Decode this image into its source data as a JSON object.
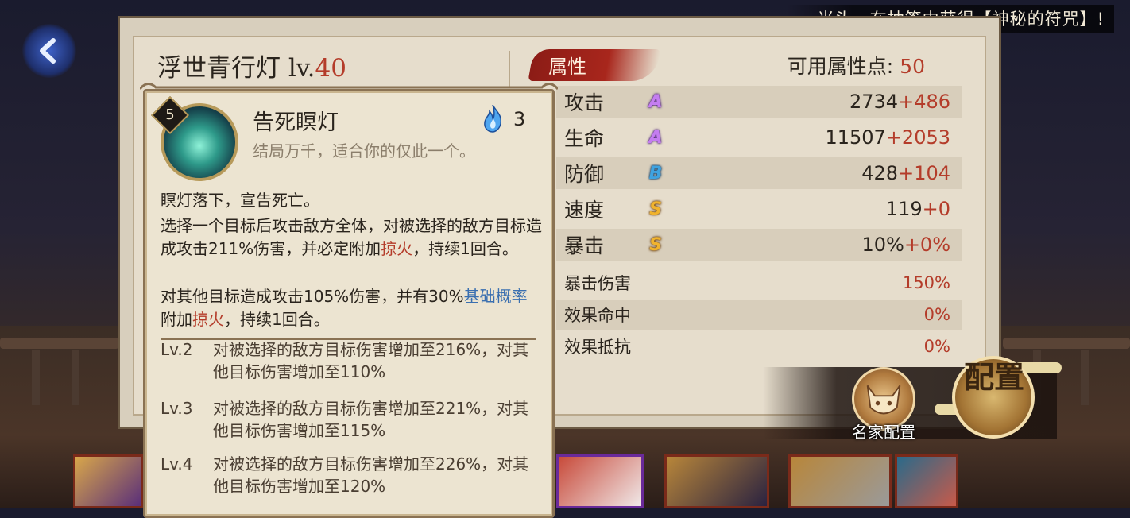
{
  "notice": {
    "text": "当头，在抽签中获得【神秘的符咒】!"
  },
  "shikigami": {
    "name": "浮世青行灯",
    "lv_prefix": "lv.",
    "level": "40"
  },
  "attributes": {
    "section_label": "属性",
    "points_label": "可用属性点:",
    "points_value": "50",
    "stats": [
      {
        "name": "攻击",
        "grade": "A",
        "base": "2734",
        "bonus": "+486"
      },
      {
        "name": "生命",
        "grade": "A",
        "base": "11507",
        "bonus": "+2053"
      },
      {
        "name": "防御",
        "grade": "B",
        "base": "428",
        "bonus": "+104"
      },
      {
        "name": "速度",
        "grade": "S",
        "base": "119",
        "bonus": "+0"
      },
      {
        "name": "暴击",
        "grade": "S",
        "base": "10%",
        "bonus": "+0%"
      }
    ],
    "sub_stats": [
      {
        "name": "暴击伤害",
        "value": "150%"
      },
      {
        "name": "效果命中",
        "value": "0%"
      },
      {
        "name": "效果抵抗",
        "value": "0%"
      }
    ]
  },
  "skill": {
    "badge": "5",
    "name": "告死瞑灯",
    "quote": "结局万千，适合你的仅此一个。",
    "cost": "3",
    "desc1": "瞑灯落下，宣告死亡。",
    "desc2_a": "选择一个目标后攻击敌方全体，对被选择的敌方目标造成攻击211%伤害，并必定附加",
    "desc2_red": "掠火",
    "desc2_b": "，持续1回合。",
    "desc3_a": "对其他目标造成攻击105%伤害，并有30%",
    "desc3_blue": "基础概率",
    "desc3_b": "附加",
    "desc3_red": "掠火",
    "desc3_c": "，持续1回合。",
    "levels": [
      {
        "tag": "Lv.2",
        "text": "对被选择的敌方目标伤害增加至216%，对其他目标伤害增加至110%"
      },
      {
        "tag": "Lv.3",
        "text": "对被选择的敌方目标伤害增加至221%，对其他目标伤害增加至115%"
      },
      {
        "tag": "Lv.4",
        "text": "对被选择的敌方目标伤害增加至226%，对其他目标伤害增加至120%"
      }
    ]
  },
  "config": {
    "preset_label": "名家配置",
    "config_label": "配置"
  },
  "icons": {
    "back": "back-arrow-icon",
    "fire": "blue-fire-icon",
    "preset": "fox-mask-icon"
  }
}
